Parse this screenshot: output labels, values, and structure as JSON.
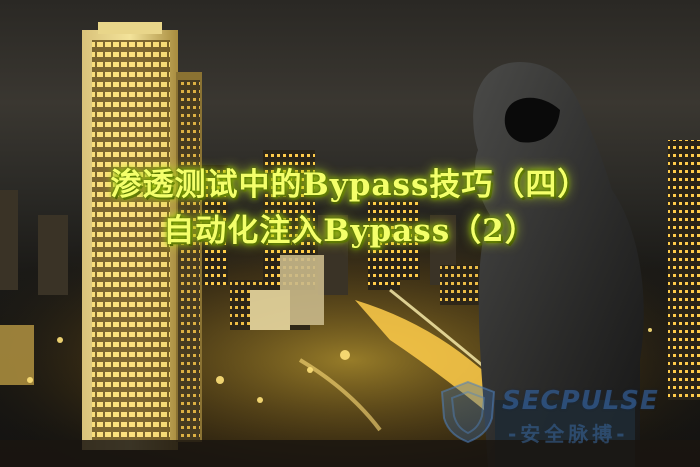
{
  "title": {
    "line1": "渗透测试中的Bypass技巧（四）",
    "line2": "自动化注入Bypass（2）"
  },
  "watermark": {
    "brand": "SECPULSE",
    "subtitle": "-安全脉搏-"
  },
  "colors": {
    "title_glow": "#d6ff2a",
    "title_fill": "#f4ff6a",
    "city_light": "#ffd23a",
    "watermark": "#3c6eaa"
  }
}
